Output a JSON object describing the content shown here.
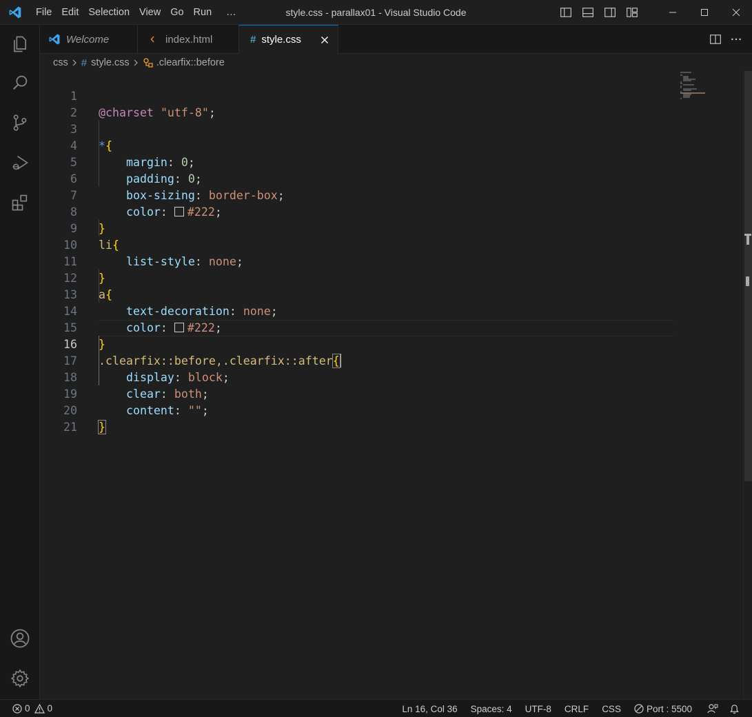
{
  "window": {
    "title": "style.css - parallax01 - Visual Studio Code",
    "menu": [
      "File",
      "Edit",
      "Selection",
      "View",
      "Go",
      "Run",
      "…"
    ]
  },
  "tabs": [
    {
      "label": "Welcome",
      "icon": "vscode-logo-icon",
      "active": false
    },
    {
      "label": "index.html",
      "icon": "html-file-icon",
      "active": false
    },
    {
      "label": "style.css",
      "icon": "css-file-icon",
      "active": true
    }
  ],
  "breadcrumb": {
    "folder": "css",
    "file_hash": "#",
    "file": "style.css",
    "symbol": ".clearfix::before"
  },
  "editor": {
    "active_line": 16,
    "line_numbers": [
      "1",
      "2",
      "3",
      "4",
      "5",
      "6",
      "7",
      "8",
      "9",
      "10",
      "11",
      "12",
      "13",
      "14",
      "15",
      "16",
      "17",
      "18",
      "19",
      "20",
      "21"
    ],
    "tokens": {
      "charset_at": "@charset",
      "charset_val": "\"utf-8\"",
      "semi": ";",
      "star": "*",
      "open": "{",
      "close": "}",
      "margin": "margin",
      "padding": "padding",
      "box_sizing": "box-sizing",
      "color": "color",
      "colon": ": ",
      "zero": "0",
      "border_box": "border-box",
      "hex222": "#222",
      "li": "li",
      "list_style": "list-style",
      "none": "none",
      "a": "a",
      "text_decoration": "text-decoration",
      "clearfix_sel": ".clearfix::before,.clearfix::after",
      "display": "display",
      "block": "block",
      "clear": "clear",
      "both": "both",
      "content": "content",
      "empty_str": "\"\""
    },
    "swatch_color": "#222222"
  },
  "statusbar": {
    "errors": "0",
    "warnings": "0",
    "position": "Ln 16, Col 36",
    "spaces": "Spaces: 4",
    "encoding": "UTF-8",
    "eol": "CRLF",
    "language": "CSS",
    "port": "Port : 5500"
  },
  "colors": {
    "accent": "#0078d4",
    "background": "#1f1f1f",
    "sidebar": "#181818"
  }
}
